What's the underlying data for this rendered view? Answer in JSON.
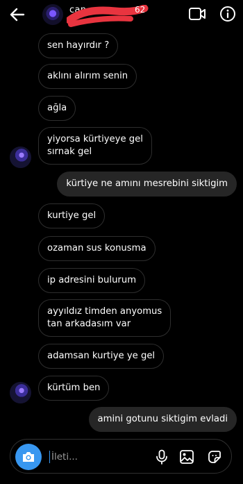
{
  "header": {
    "contact_name": "can",
    "name_suffix": "62"
  },
  "messages": [
    {
      "text": "sen hayırdır ?",
      "direction": "in"
    },
    {
      "text": "aklını alırım senin",
      "direction": "in"
    },
    {
      "text": "ağla",
      "direction": "in"
    },
    {
      "text": "yiyorsa kürtiyeye gel\nsırnak gel",
      "direction": "in"
    },
    {
      "text": "kürtiye ne amını mesrebini siktigim",
      "direction": "out"
    },
    {
      "text": "kurtiye gel",
      "direction": "in"
    },
    {
      "text": "ozaman sus konusma",
      "direction": "in"
    },
    {
      "text": "ip adresini bulurum",
      "direction": "in"
    },
    {
      "text": "ayyıldız timden anyomus\ntan arkadasım var",
      "direction": "in"
    },
    {
      "text": "adamsan kurtiye ye gel",
      "direction": "in"
    },
    {
      "text": "kürtüm ben",
      "direction": "in"
    },
    {
      "text": "amini gotunu siktigim evladi",
      "direction": "out"
    }
  ],
  "composer": {
    "placeholder": "İleti..."
  },
  "colors": {
    "background": "#000000",
    "outgoing_bubble": "#262626",
    "incoming_border": "#2e2e2e",
    "accent": "#3897f0",
    "redaction": "#e8343f"
  },
  "icons": [
    "back-arrow-icon",
    "video-call-icon",
    "info-icon",
    "camera-icon",
    "microphone-icon",
    "gallery-icon",
    "sticker-icon"
  ]
}
